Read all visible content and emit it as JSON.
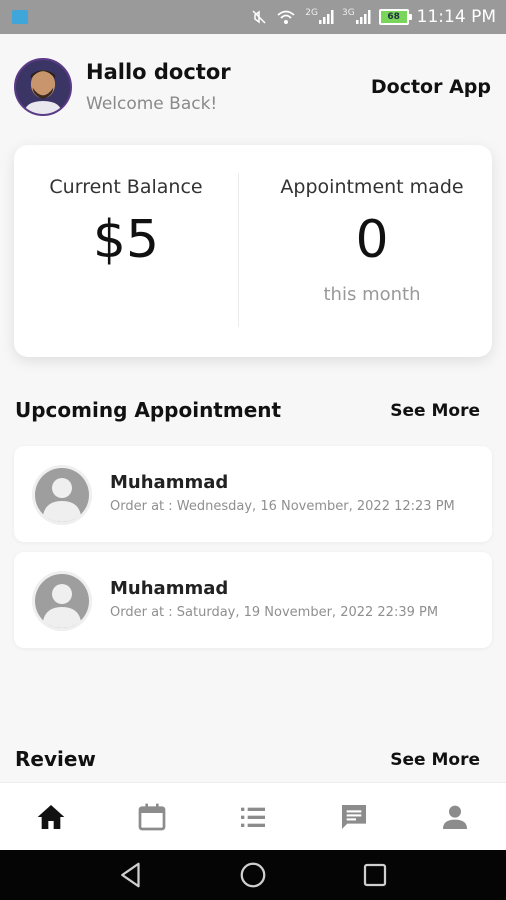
{
  "status_bar": {
    "network_1": "2G",
    "network_2": "3G",
    "battery_level": "68",
    "time": "11:14 PM"
  },
  "header": {
    "greeting": "Hallo doctor",
    "subtitle": "Welcome Back!",
    "app_name": "Doctor App"
  },
  "balance_card": {
    "balance_label": "Current Balance",
    "balance_value": "$5",
    "appointments_label": "Appointment made",
    "appointments_value": "0",
    "appointments_period": "this month"
  },
  "upcoming": {
    "title": "Upcoming Appointment",
    "see_more": "See More",
    "items": [
      {
        "name": "Muhammad",
        "order": "Order at : Wednesday, 16 November, 2022 12:23 PM"
      },
      {
        "name": "Muhammad",
        "order": "Order at : Saturday, 19 November, 2022 22:39 PM"
      }
    ]
  },
  "review": {
    "title": "Review",
    "see_more": "See More"
  },
  "bottom_nav": {
    "items": [
      "home-icon",
      "calendar-icon",
      "list-icon",
      "chat-icon",
      "profile-icon"
    ],
    "active": "home-icon"
  },
  "colors": {
    "status_bar": "#9a9a9a",
    "background": "#f7f7f7",
    "card": "#ffffff",
    "muted_text": "#8a8a8a",
    "active_icon": "#111111",
    "inactive_icon": "#8c8c8c"
  }
}
